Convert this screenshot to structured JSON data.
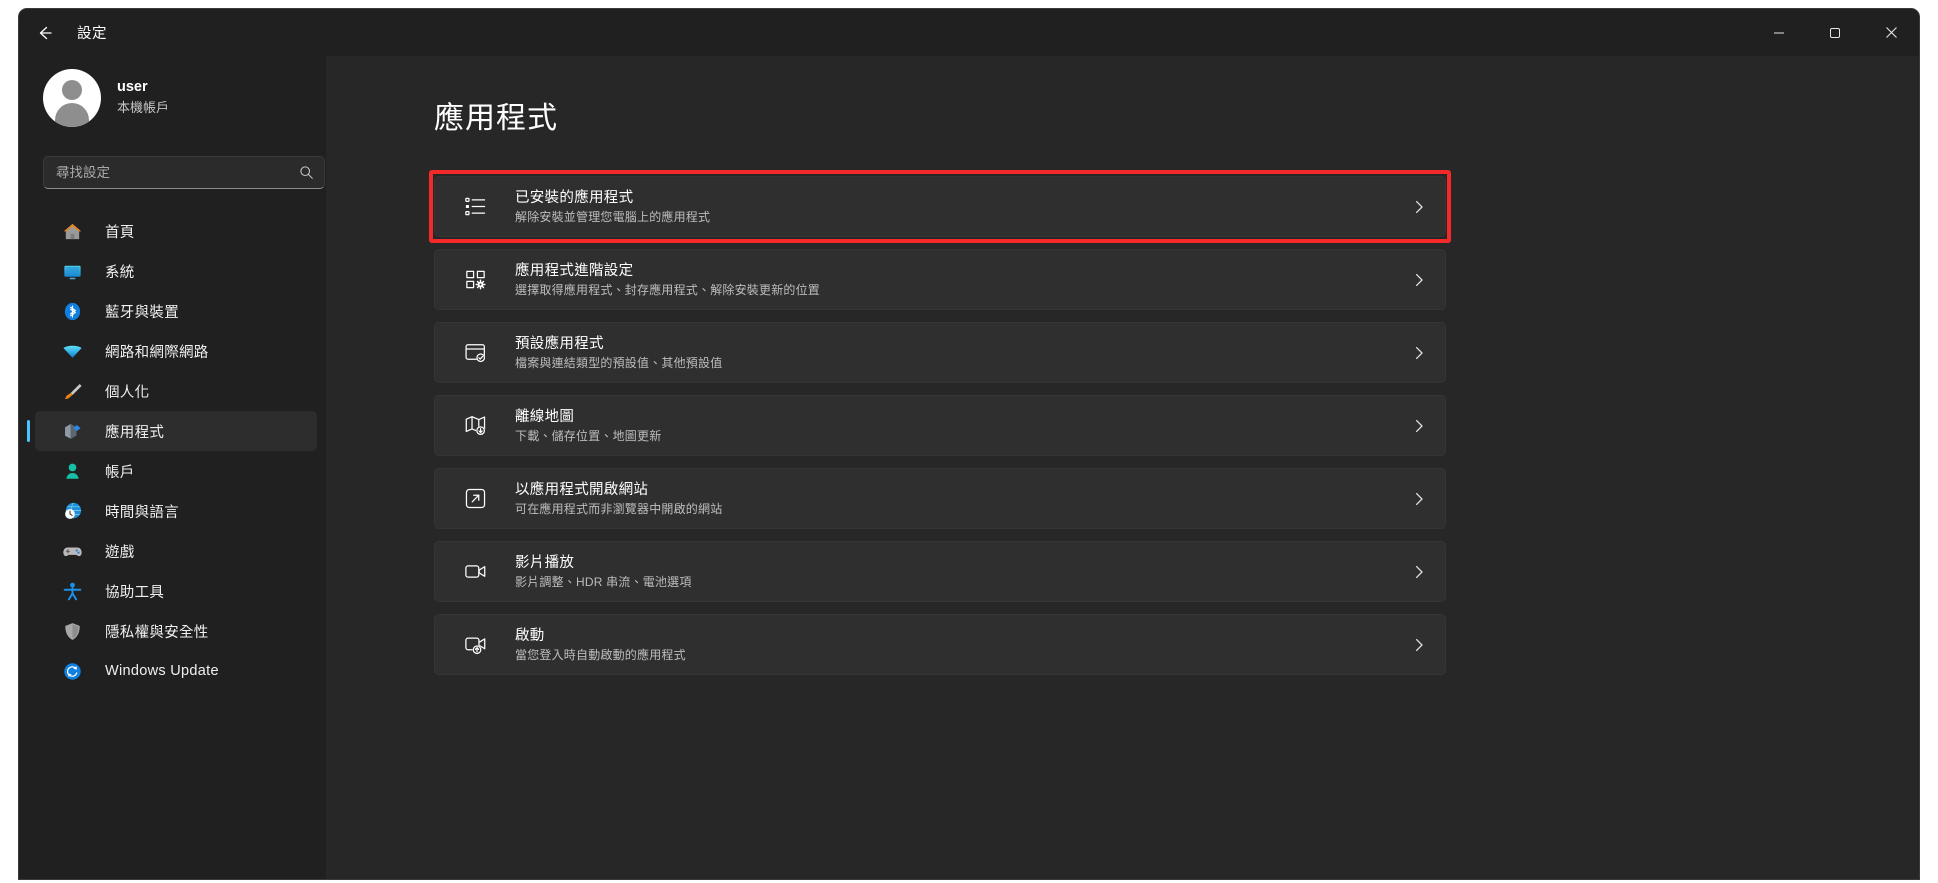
{
  "window": {
    "title": "設定",
    "back_icon": "back-arrow-icon",
    "controls": [
      {
        "name": "minimize",
        "glyph": "minimize-icon"
      },
      {
        "name": "maximize",
        "glyph": "maximize-icon"
      },
      {
        "name": "close",
        "glyph": "close-icon"
      }
    ]
  },
  "sidebar": {
    "profile": {
      "name": "user",
      "account_type": "本機帳戶",
      "avatar_icon": "user-avatar-icon"
    },
    "search": {
      "placeholder": "尋找設定",
      "value": "",
      "icon": "search-icon"
    },
    "items": [
      {
        "label": "首頁",
        "icon": "home-icon",
        "selected": false
      },
      {
        "label": "系統",
        "icon": "system-monitor-icon",
        "selected": false
      },
      {
        "label": "藍牙與裝置",
        "icon": "bluetooth-icon",
        "selected": false
      },
      {
        "label": "網路和網際網路",
        "icon": "wifi-icon",
        "selected": false
      },
      {
        "label": "個人化",
        "icon": "paintbrush-icon",
        "selected": false
      },
      {
        "label": "應用程式",
        "icon": "apps-icon",
        "selected": true
      },
      {
        "label": "帳戶",
        "icon": "accounts-person-icon",
        "selected": false
      },
      {
        "label": "時間與語言",
        "icon": "time-language-globe-icon",
        "selected": false
      },
      {
        "label": "遊戲",
        "icon": "gamepad-icon",
        "selected": false
      },
      {
        "label": "協助工具",
        "icon": "accessibility-person-icon",
        "selected": false
      },
      {
        "label": "隱私權與安全性",
        "icon": "shield-icon",
        "selected": false
      },
      {
        "label": "Windows Update",
        "icon": "windows-update-sync-icon",
        "selected": false
      }
    ]
  },
  "main": {
    "page_title": "應用程式",
    "highlight_color": "#f42a2a",
    "cards": [
      {
        "title": "已安裝的應用程式",
        "subtitle": "解除安裝並管理您電腦上的應用程式",
        "icon": "installed-apps-list-icon",
        "highlighted": true
      },
      {
        "title": "應用程式進階設定",
        "subtitle": "選擇取得應用程式、封存應用程式、解除安裝更新的位置",
        "icon": "advanced-app-settings-icon",
        "highlighted": false
      },
      {
        "title": "預設應用程式",
        "subtitle": "檔案與連結類型的預設值、其他預設值",
        "icon": "default-apps-check-icon",
        "highlighted": false
      },
      {
        "title": "離線地圖",
        "subtitle": "下載、儲存位置、地圖更新",
        "icon": "offline-maps-icon",
        "highlighted": false
      },
      {
        "title": "以應用程式開啟網站",
        "subtitle": "可在應用程式而非瀏覽器中開啟的網站",
        "icon": "open-website-external-icon",
        "highlighted": false
      },
      {
        "title": "影片播放",
        "subtitle": "影片調整、HDR 串流、電池選項",
        "icon": "video-playback-camera-icon",
        "highlighted": false
      },
      {
        "title": "啟動",
        "subtitle": "當您登入時自動啟動的應用程式",
        "icon": "startup-apps-icon",
        "highlighted": false
      }
    ],
    "chevron_icon": "chevron-right-icon"
  }
}
